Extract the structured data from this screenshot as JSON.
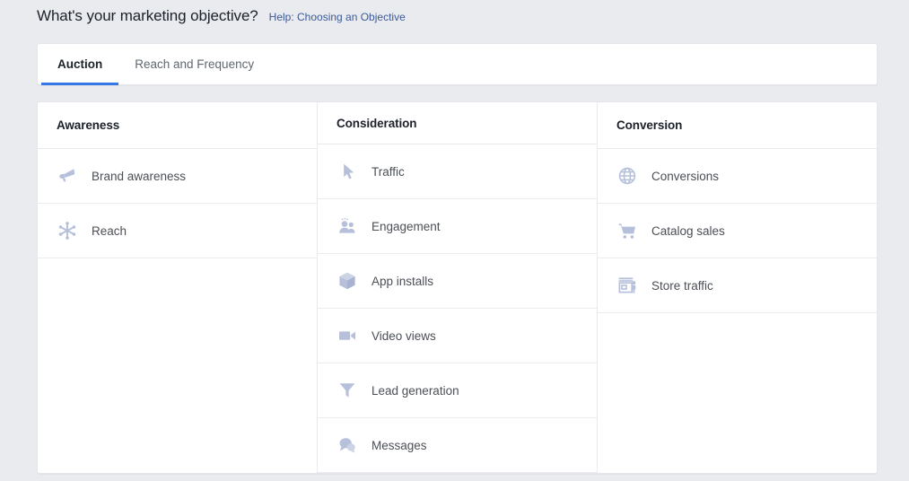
{
  "header": {
    "title": "What's your marketing objective?",
    "help_link": "Help: Choosing an Objective"
  },
  "tabs": [
    {
      "label": "Auction",
      "active": true
    },
    {
      "label": "Reach and Frequency",
      "active": false
    }
  ],
  "columns": [
    {
      "header": "Awareness",
      "items": [
        {
          "label": "Brand awareness",
          "icon": "megaphone-icon"
        },
        {
          "label": "Reach",
          "icon": "starburst-icon"
        }
      ]
    },
    {
      "header": "Consideration",
      "items": [
        {
          "label": "Traffic",
          "icon": "cursor-arrow-icon"
        },
        {
          "label": "Engagement",
          "icon": "people-icon"
        },
        {
          "label": "App installs",
          "icon": "box-icon"
        },
        {
          "label": "Video views",
          "icon": "video-camera-icon"
        },
        {
          "label": "Lead generation",
          "icon": "funnel-icon"
        },
        {
          "label": "Messages",
          "icon": "chat-bubbles-icon"
        }
      ]
    },
    {
      "header": "Conversion",
      "items": [
        {
          "label": "Conversions",
          "icon": "globe-icon"
        },
        {
          "label": "Catalog sales",
          "icon": "shopping-cart-icon"
        },
        {
          "label": "Store traffic",
          "icon": "storefront-icon"
        }
      ]
    }
  ],
  "colors": {
    "page_background": "#e9ebee",
    "card_background": "#ffffff",
    "accent_blue": "#3578e5",
    "link_blue": "#3b5998",
    "icon_blue": "#b7c0da",
    "heading_text": "#1d2129",
    "label_text": "#4b4f56",
    "muted_text": "#606770"
  }
}
